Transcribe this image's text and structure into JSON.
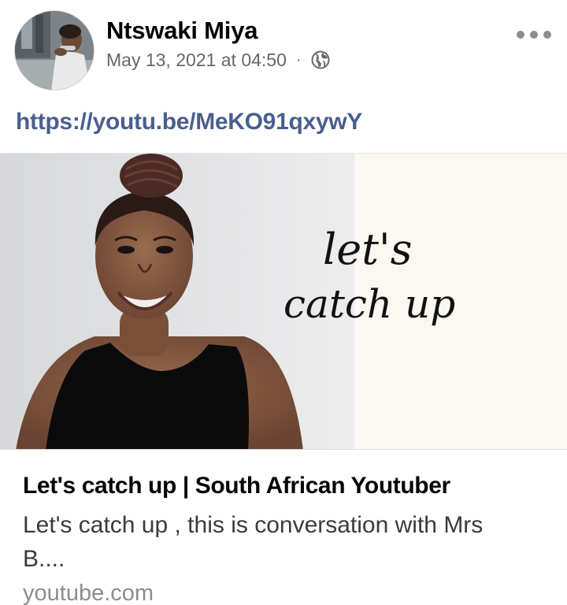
{
  "post": {
    "author": "Ntswaki Miya",
    "timestamp": "May 13, 2021 at 04:50",
    "separator": "·",
    "privacy_icon": "globe-icon",
    "more_icon": "more-dots-icon",
    "link_text": "https://youtu.be/MeKO91qxywY"
  },
  "link_preview": {
    "overlay_text_line1": "let's",
    "overlay_text_line2": "catch up",
    "title": "Let's catch up | South African Youtuber",
    "description": "Let's catch up , this is conversation with Mrs B....",
    "domain": "youtube.com"
  },
  "colors": {
    "link": "#4a5f8e",
    "secondary_text": "#65676b",
    "domain_text": "#8a8d91"
  }
}
